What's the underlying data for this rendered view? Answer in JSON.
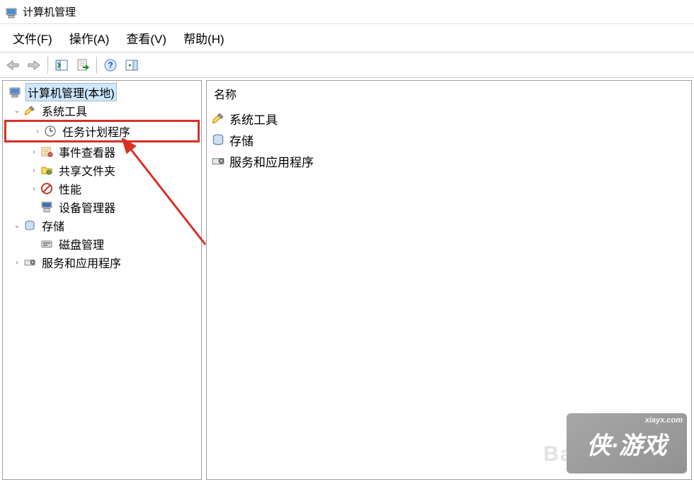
{
  "window": {
    "title": "计算机管理"
  },
  "menubar": {
    "file": "文件(F)",
    "action": "操作(A)",
    "view": "查看(V)",
    "help": "帮助(H)"
  },
  "tree": {
    "root": "计算机管理(本地)",
    "system_tools": "系统工具",
    "task_scheduler": "任务计划程序",
    "event_viewer": "事件查看器",
    "shared_folders": "共享文件夹",
    "performance": "性能",
    "device_manager": "设备管理器",
    "storage": "存储",
    "disk_management": "磁盘管理",
    "services_apps": "服务和应用程序"
  },
  "list": {
    "header": "名称",
    "items": {
      "system_tools": "系统工具",
      "storage": "存储",
      "services_apps": "服务和应用程序"
    }
  },
  "watermark": {
    "site": "xiayx.com",
    "brand": "侠·游戏",
    "bg_text": "Bai"
  }
}
